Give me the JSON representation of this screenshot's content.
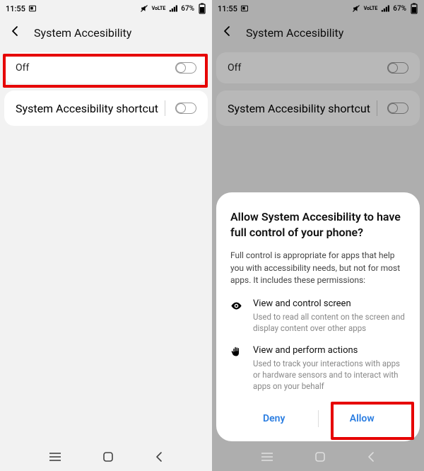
{
  "status": {
    "time": "11:55",
    "battery": "67%"
  },
  "header": {
    "title": "System Accesibility"
  },
  "rows": {
    "main_label": "Off",
    "shortcut_label": "System Accesibility shortcut"
  },
  "dialog": {
    "title": "Allow System Accesibility to have full control of your phone?",
    "desc": "Full control is appropriate for apps that help you with accessibility needs, but not for most apps. It includes these permissions:",
    "perm1": {
      "label": "View and control screen",
      "sub": "Used to read all content on the screen and display content over other apps"
    },
    "perm2": {
      "label": "View and perform actions",
      "sub": "Used to track your interactions with apps or hardware sensors and to interact with apps on your behalf"
    },
    "deny": "Deny",
    "allow": "Allow"
  }
}
